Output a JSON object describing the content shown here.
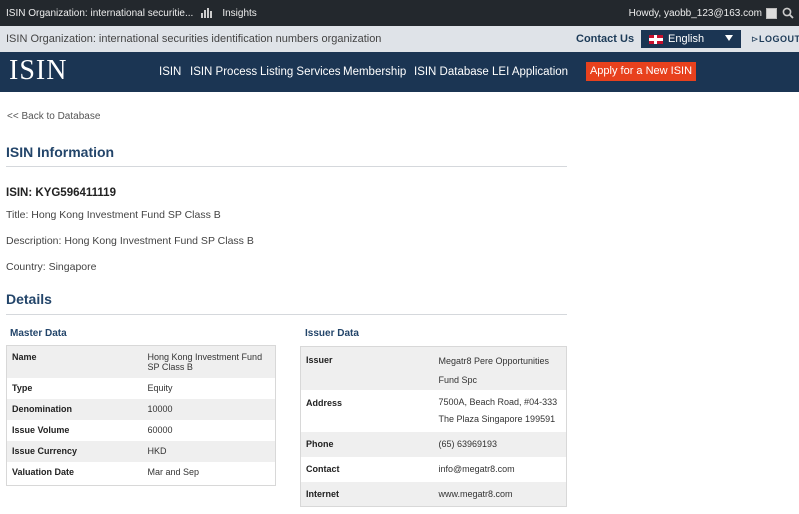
{
  "adminbar": {
    "site_name": "ISIN Organization: international securitie...",
    "insights": "Insights",
    "howdy": "Howdy, yaobb_123@163.com"
  },
  "topstrip": {
    "org_name": "ISIN Organization: international securities identification numbers organization",
    "contact": "Contact Us",
    "language": "English",
    "logout": "LOGOUT"
  },
  "nav": {
    "logo": "ISIN",
    "items": [
      {
        "label": "ISIN"
      },
      {
        "label": "ISIN Process"
      },
      {
        "label": "Listing Services"
      },
      {
        "label": "Membership"
      },
      {
        "label": "ISIN Database"
      },
      {
        "label": "LEI Application"
      }
    ],
    "apply": "Apply for a New ISIN"
  },
  "content": {
    "back": "<< Back to Database",
    "info_heading": "ISIN Information",
    "isin": "ISIN: KYG596411119",
    "title": "Title: Hong Kong Investment Fund SP Class B",
    "description": "Description: Hong Kong Investment Fund SP Class B",
    "country": "Country: Singapore",
    "details_heading": "Details"
  },
  "master": {
    "heading": "Master Data",
    "rows": [
      {
        "k": "Name",
        "v": "Hong Kong Investment Fund SP Class B"
      },
      {
        "k": "Type",
        "v": "Equity"
      },
      {
        "k": "Denomination",
        "v": "10000"
      },
      {
        "k": "Issue Volume",
        "v": "60000"
      },
      {
        "k": "Issue Currency",
        "v": "HKD"
      },
      {
        "k": "Valuation Date",
        "v": "Mar and Sep"
      }
    ]
  },
  "issuer": {
    "heading": "Issuer Data",
    "rows": [
      {
        "k": "Issuer",
        "v": "Megatr8 Pere Opportunities Fund Spc"
      },
      {
        "k": "Address",
        "v": "7500A, Beach Road, #04-333 The Plaza Singapore 199591"
      },
      {
        "k": "Phone",
        "v": "(65) 63969193"
      },
      {
        "k": "Contact",
        "v": "info@megatr8.com"
      },
      {
        "k": "Internet",
        "v": "www.megatr8.com"
      }
    ]
  },
  "colors": {
    "navy": "#1b3553",
    "accent_orange": "#e8411d",
    "heading_blue": "#23456a"
  }
}
